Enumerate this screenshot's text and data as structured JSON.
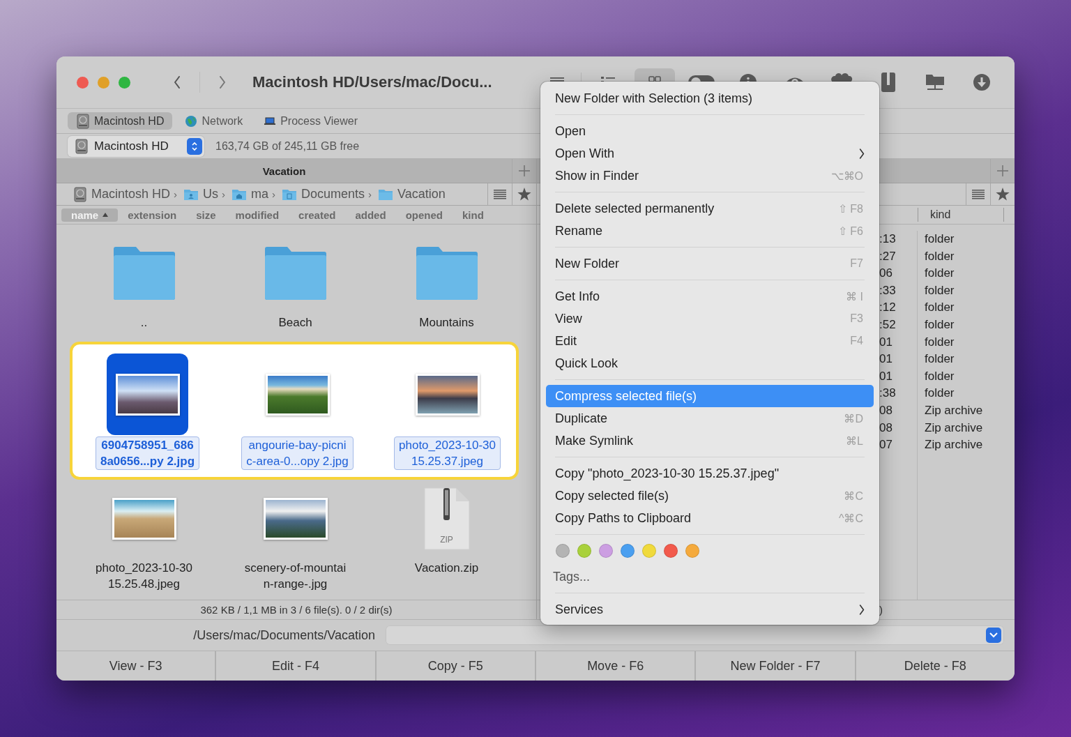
{
  "window": {
    "title": "Macintosh HD/Users/mac/Docu..."
  },
  "toolbar": [
    {
      "kind": "hamburger",
      "selected": false
    },
    {
      "kind": "list",
      "selected": false
    },
    {
      "kind": "grid",
      "selected": true
    },
    {
      "kind": "toggle",
      "selected": false
    },
    {
      "kind": "info",
      "selected": false
    },
    {
      "kind": "eye",
      "selected": false
    },
    {
      "kind": "brain",
      "selected": false
    },
    {
      "kind": "archive",
      "selected": false
    },
    {
      "kind": "network",
      "selected": false
    },
    {
      "kind": "download",
      "selected": false
    }
  ],
  "tabs": [
    {
      "label": "Macintosh HD",
      "kind": "drive",
      "selected": true
    },
    {
      "label": "Network",
      "kind": "globe",
      "selected": false
    },
    {
      "label": "Process Viewer",
      "kind": "laptop",
      "selected": false
    }
  ],
  "drive": {
    "name": "Macintosh HD",
    "free": "163,74 GB of 245,11 GB free"
  },
  "left_panel": {
    "title": "Vacation",
    "breadcrumb": [
      {
        "label": "Macintosh HD",
        "kind": "drive",
        "separator": "›"
      },
      {
        "label": "Us",
        "kind": "user-folder",
        "separator": "›"
      },
      {
        "label": "ma",
        "kind": "home-folder",
        "separator": "›"
      },
      {
        "label": "Documents",
        "kind": "doc-folder",
        "separator": "›"
      },
      {
        "label": "Vacation",
        "kind": "folder"
      }
    ],
    "columns": [
      {
        "label": "name",
        "selected": true
      },
      {
        "label": "extension",
        "selected": false
      },
      {
        "label": "size",
        "selected": false
      },
      {
        "label": "modified",
        "selected": false
      },
      {
        "label": "created",
        "selected": false
      },
      {
        "label": "added",
        "selected": false
      },
      {
        "label": "opened",
        "selected": false
      },
      {
        "label": "kind",
        "selected": false
      }
    ],
    "icon_rows": [
      {
        "highlighted": false,
        "items": [
          {
            "kind": "folder",
            "lines": [
              ".."
            ],
            "selected": false,
            "focused": false
          },
          {
            "kind": "folder",
            "lines": [
              "Beach"
            ],
            "selected": false,
            "focused": false
          },
          {
            "kind": "folder",
            "lines": [
              "Mountains"
            ],
            "selected": false,
            "focused": false
          }
        ]
      },
      {
        "highlighted": true,
        "items": [
          {
            "kind": "photo",
            "lines": [
              "6904758951_686",
              "8a0656...py 2.jpg"
            ],
            "selected": true,
            "focused": true
          },
          {
            "kind": "photo",
            "lines": [
              "angourie-bay-picni",
              "c-area-0...opy 2.jpg"
            ],
            "selected": true,
            "focused": false
          },
          {
            "kind": "photo",
            "lines": [
              "photo_2023-10-30",
              "15.25.37.jpeg"
            ],
            "selected": true,
            "focused": false
          }
        ]
      },
      {
        "highlighted": false,
        "items": [
          {
            "kind": "photo",
            "lines": [
              "photo_2023-10-30",
              "15.25.48.jpeg"
            ],
            "selected": false,
            "focused": false
          },
          {
            "kind": "photo",
            "lines": [
              "scenery-of-mountai",
              "n-range-.jpg"
            ],
            "selected": false,
            "focused": false
          },
          {
            "kind": "zip",
            "badge": "ZIP",
            "lines": [
              "Vacation.zip"
            ],
            "selected": false,
            "focused": false
          }
        ]
      }
    ],
    "status": "362 KB / 1,1 MB in 3 / 6 file(s). 0 / 2 dir(s)"
  },
  "right_panel": {
    "columns": [
      "kind"
    ],
    "rows": [
      {
        "column_1": ":13",
        "kind": "folder"
      },
      {
        "column_1": ":27",
        "kind": "folder"
      },
      {
        "column_1": "06",
        "kind": "folder"
      },
      {
        "column_1": ":33",
        "kind": "folder"
      },
      {
        "column_1": ":12",
        "kind": "folder"
      },
      {
        "column_1": ":52",
        "kind": "folder"
      },
      {
        "column_1": "01",
        "kind": "folder"
      },
      {
        "column_1": "01",
        "kind": "folder"
      },
      {
        "column_1": "01",
        "kind": "folder"
      },
      {
        "column_1": ":38",
        "kind": "folder"
      },
      {
        "column_1": "08",
        "kind": "Zip archive"
      },
      {
        "column_1": "08",
        "kind": "Zip archive"
      },
      {
        "column_1": "07",
        "kind": "Zip archive"
      }
    ],
    "status": ")"
  },
  "command_line": {
    "path": "/Users/mac/Documents/Vacation"
  },
  "function_keys": [
    "View - F3",
    "Edit - F4",
    "Copy - F5",
    "Move - F6",
    "New Folder - F7",
    "Delete - F8"
  ],
  "context_menu": {
    "sections": [
      {
        "kind": "items",
        "items": [
          {
            "label": "New Folder with Selection (3 items)",
            "submenu": false,
            "selected": false
          }
        ]
      },
      {
        "kind": "items",
        "items": [
          {
            "label": "Open",
            "submenu": false,
            "selected": false
          },
          {
            "label": "Open With",
            "submenu": true,
            "selected": false
          },
          {
            "label": "Show in Finder",
            "shortcut": "⌥⌘O",
            "submenu": false,
            "selected": false
          }
        ]
      },
      {
        "kind": "items",
        "items": [
          {
            "label": "Delete selected permanently",
            "shortcut": "⇧ F8",
            "submenu": false,
            "selected": false
          },
          {
            "label": "Rename",
            "shortcut": "⇧ F6",
            "submenu": false,
            "selected": false
          }
        ]
      },
      {
        "kind": "items",
        "items": [
          {
            "label": "New Folder",
            "shortcut": "F7",
            "submenu": false,
            "selected": false
          }
        ]
      },
      {
        "kind": "items",
        "items": [
          {
            "label": "Get Info",
            "shortcut": "⌘ I",
            "submenu": false,
            "selected": false
          },
          {
            "label": "View",
            "shortcut": "F3",
            "submenu": false,
            "selected": false
          },
          {
            "label": "Edit",
            "shortcut": "F4",
            "submenu": false,
            "selected": false
          },
          {
            "label": "Quick Look",
            "submenu": false,
            "selected": false
          }
        ]
      },
      {
        "kind": "items",
        "items": [
          {
            "label": "Compress selected file(s)",
            "submenu": false,
            "selected": true
          },
          {
            "label": "Duplicate",
            "shortcut": "⌘D",
            "submenu": false,
            "selected": false
          },
          {
            "label": "Make Symlink",
            "shortcut": "⌘L",
            "submenu": false,
            "selected": false
          }
        ]
      },
      {
        "kind": "items",
        "items": [
          {
            "label": "Copy \"photo_2023-10-30 15.25.37.jpeg\"",
            "submenu": false,
            "selected": false
          },
          {
            "label": "Copy selected file(s)",
            "shortcut": "⌘C",
            "submenu": false,
            "selected": false
          },
          {
            "label": "Copy Paths to Clipboard",
            "shortcut": "^⌘C",
            "submenu": false,
            "selected": false
          }
        ]
      },
      {
        "kind": "tags",
        "colors": [
          {
            "color": "#b4b4b4"
          },
          {
            "color": "#a9d13b"
          },
          {
            "color": "#cc9ee2"
          },
          {
            "color": "#4a9ff0"
          },
          {
            "color": "#f0da3c"
          },
          {
            "color": "#f25a4c"
          },
          {
            "color": "#f5aa3c"
          }
        ],
        "label": "Tags..."
      },
      {
        "kind": "items",
        "items": [
          {
            "label": "Services",
            "submenu": true,
            "selected": false
          }
        ]
      }
    ]
  }
}
